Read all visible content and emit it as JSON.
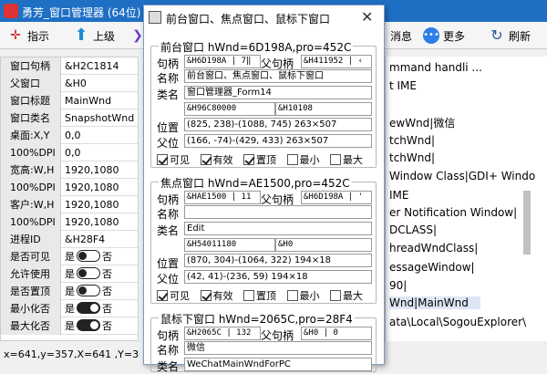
{
  "titlebar": {
    "title": "勇芳_窗口管理器 (64位)"
  },
  "toolbar": {
    "pointer": "指示",
    "up": "上级",
    "messages": "消息",
    "more": "更多",
    "refresh": "刷新"
  },
  "left_rows": [
    {
      "k": "窗口句柄",
      "v": "&H2C1814"
    },
    {
      "k": "父窗口",
      "v": "&H0"
    },
    {
      "k": "窗口标题",
      "v": "MainWnd"
    },
    {
      "k": "窗口类名",
      "v": "SnapshotWnd"
    },
    {
      "k": "桌面:X,Y",
      "v": "0,0"
    },
    {
      "k": "100%DPI",
      "v": "0,0"
    },
    {
      "k": "宽高:W,H",
      "v": "1920,1080"
    },
    {
      "k": "100%DPI",
      "v": "1920,1080"
    },
    {
      "k": "客户:W,H",
      "v": "1920,1080"
    },
    {
      "k": "100%DPI",
      "v": "1920,1080"
    },
    {
      "k": "进程ID",
      "v": "&H28F4"
    }
  ],
  "switch_rows": [
    {
      "k": "是否可见",
      "yes": "是",
      "no": "否",
      "state": "off"
    },
    {
      "k": "允许使用",
      "yes": "是",
      "no": "否",
      "state": "off"
    },
    {
      "k": "是否置顶",
      "yes": "是",
      "no": "否",
      "state": "off"
    },
    {
      "k": "最小化否",
      "yes": "是",
      "no": "否",
      "state": "on"
    },
    {
      "k": "最大化否",
      "yes": "是",
      "no": "否",
      "state": "on"
    }
  ],
  "status": "x=641,y=357,X=641 ,Y=3",
  "right_lines": [
    "mmand handli ...",
    "t IME",
    "ewWnd|微信",
    "tchWnd|",
    "tchWnd|",
    "Window Class|GDI+ Windo",
    "IME",
    "er Notification Window|",
    "DCLASS|",
    "hreadWndClass|",
    "essageWindow|",
    "90|",
    "Wnd|MainWnd",
    "ata\\Local\\SogouExplorer\\"
  ],
  "popup": {
    "title": "前台窗口、焦点窗口、鼠标下窗口",
    "labels": {
      "handle": "句柄",
      "parent": "父句柄",
      "name": "名称",
      "class": "类名",
      "pos": "位置",
      "parentpos": "父位"
    },
    "checkbox_labels": [
      "可见",
      "有效",
      "置顶",
      "最小",
      "最大"
    ],
    "groups": [
      {
        "title": "前台窗口 hWnd=6D198A,pro=452C",
        "handle": "&H6D198A | 7‖",
        "parent": "&H411952 | ‹",
        "name": "前台窗口、焦点窗口、鼠标下窗口",
        "class": "窗口管理器_Form14",
        "f1": "&H96C80000",
        "f2": "&H10108",
        "pos": "(825, 238)-(1088, 745) 263×507",
        "parentpos": "(166, -74)-(429, 433) 263×507",
        "checks": [
          true,
          true,
          true,
          false,
          false
        ]
      },
      {
        "title": "焦点窗口 hWnd=AE1500,pro=452C",
        "handle": "&HAE1500 | 11",
        "parent": "&H6D198A | '",
        "name": "",
        "class": "Edit",
        "f1": "&H54011180",
        "f2": "&H0",
        "pos": "(870, 304)-(1064, 322) 194×18",
        "parentpos": "(42, 41)-(236, 59) 194×18",
        "checks": [
          true,
          true,
          false,
          false,
          false
        ]
      },
      {
        "title": "鼠标下窗口 hWnd=2065C,pro=28F4",
        "handle": "&H2065C | 132",
        "parent": "&H0 | 0",
        "name": "微信",
        "class": "WeChatMainWndForPC"
      }
    ]
  },
  "colors": {
    "titlebar": "#1f6fc5",
    "selection": "#dde6f4"
  }
}
